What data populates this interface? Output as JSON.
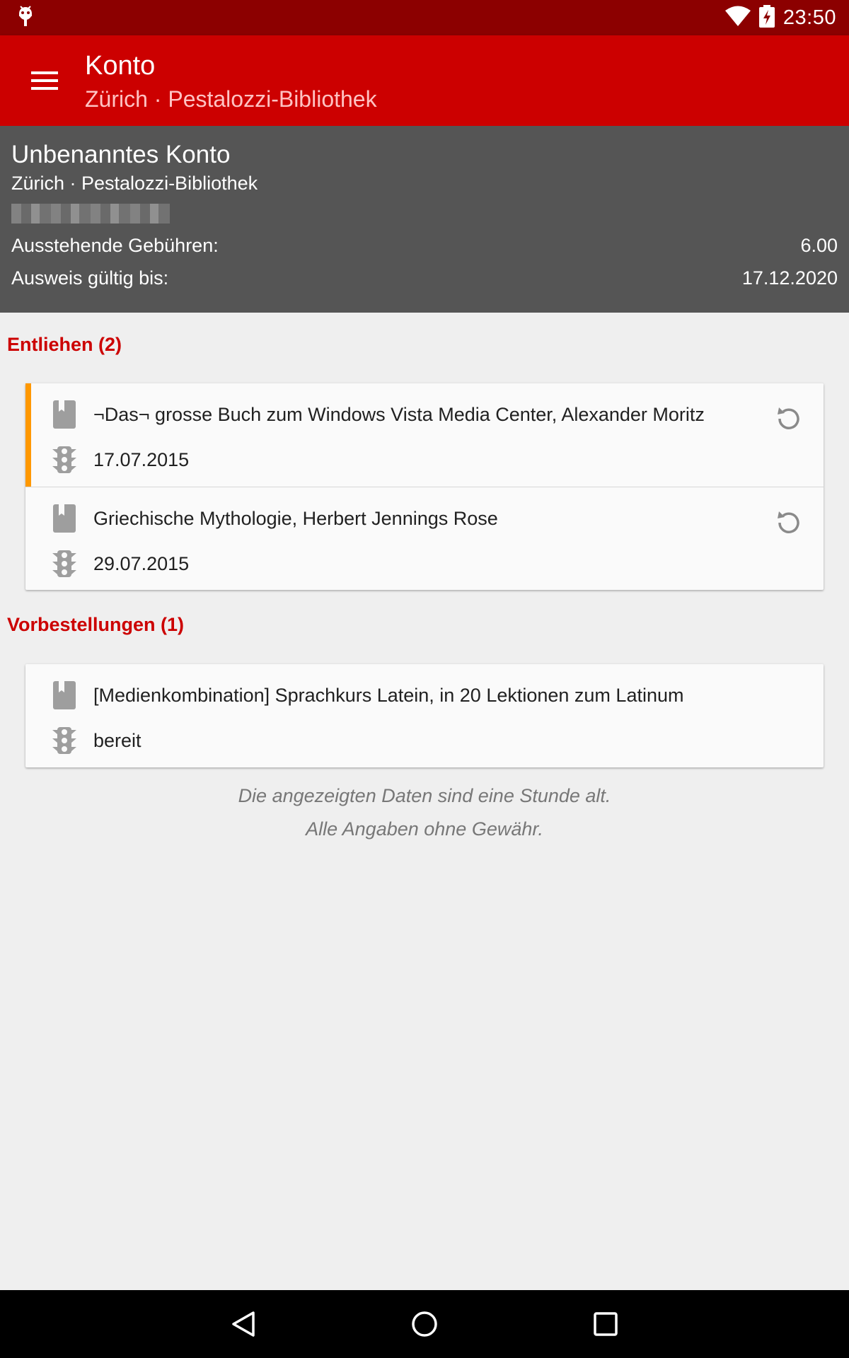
{
  "status_bar": {
    "time": "23:50",
    "icons": [
      "android-debug-icon",
      "wifi-icon",
      "battery-charging-icon"
    ]
  },
  "app_bar": {
    "title": "Konto",
    "subtitle": "Zürich · Pestalozzi-Bibliothek",
    "menu_icon": "hamburger-menu-icon"
  },
  "account": {
    "name": "Unbenanntes Konto",
    "library": "Zürich · Pestalozzi-Bibliothek",
    "fees_label": "Ausstehende Gebühren:",
    "fees_value": "6.00",
    "valid_label": "Ausweis gültig bis:",
    "valid_value": "17.12.2020"
  },
  "lent": {
    "title": "Entliehen (2)",
    "items": [
      {
        "title": "¬Das¬ grosse Buch zum Windows Vista Media Center, Alexander Moritz",
        "date": "17.07.2015",
        "overdue": true
      },
      {
        "title": "Griechische Mythologie, Herbert Jennings Rose",
        "date": "29.07.2015",
        "overdue": false
      }
    ]
  },
  "reservations": {
    "title": "Vorbestellungen (1)",
    "items": [
      {
        "title": "[Medienkombination] Sprachkurs Latein, in 20 Lektionen zum Latinum",
        "status": "bereit"
      }
    ]
  },
  "footer": {
    "line1": "Die angezeigten Daten sind eine Stunde alt.",
    "line2": "Alle Angaben ohne Gewähr."
  },
  "colors": {
    "primary": "#cc0000",
    "primary_dark": "#8c0000",
    "header_bg": "#555555",
    "overdue": "#ff9800",
    "icon_grey": "#9e9e9e"
  }
}
